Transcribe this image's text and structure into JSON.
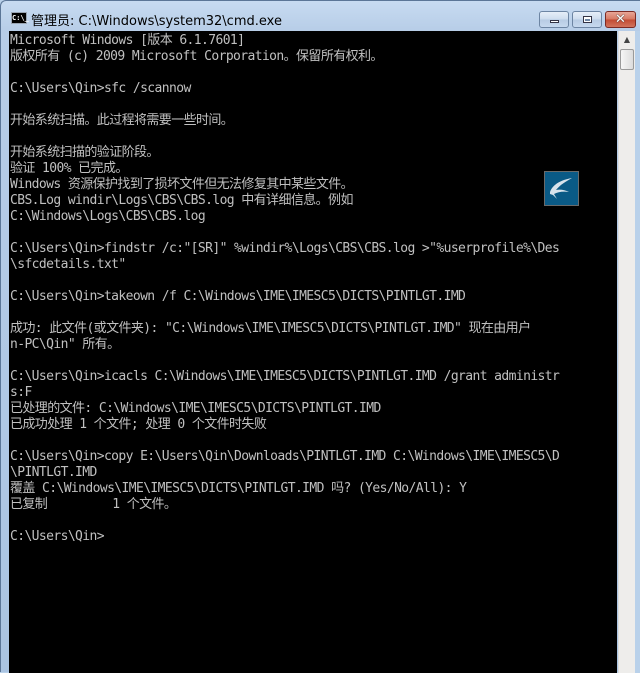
{
  "window": {
    "title": "管理员: C:\\Windows\\system32\\cmd.exe",
    "icon": "cmd-icon",
    "icon_label": "C:\\_",
    "buttons": {
      "minimize": "minimize-icon",
      "maximize": "maximize-icon",
      "close": "close-icon",
      "close_glyph": "✕"
    }
  },
  "console": {
    "background": "#000000",
    "foreground": "#c0c0c0",
    "lines": [
      "Microsoft Windows [版本 6.1.7601]",
      "版权所有 (c) 2009 Microsoft Corporation。保留所有权利。",
      "",
      "C:\\Users\\Qin>sfc /scannow",
      "",
      "开始系统扫描。此过程将需要一些时间。",
      "",
      "开始系统扫描的验证阶段。",
      "验证 100% 已完成。",
      "Windows 资源保护找到了损坏文件但无法修复其中某些文件。",
      "CBS.Log windir\\Logs\\CBS\\CBS.log 中有详细信息。例如",
      "C:\\Windows\\Logs\\CBS\\CBS.log",
      "",
      "C:\\Users\\Qin>findstr /c:\"[SR]\" %windir%\\Logs\\CBS\\CBS.log >\"%userprofile%\\Des",
      "\\sfcdetails.txt\"",
      "",
      "C:\\Users\\Qin>takeown /f C:\\Windows\\IME\\IMESC5\\DICTS\\PINTLGT.IMD",
      "",
      "成功: 此文件(或文件夹): \"C:\\Windows\\IME\\IMESC5\\DICTS\\PINTLGT.IMD\" 现在由用户",
      "n-PC\\Qin\" 所有。",
      "",
      "C:\\Users\\Qin>icacls C:\\Windows\\IME\\IMESC5\\DICTS\\PINTLGT.IMD /grant administr",
      "s:F",
      "已处理的文件: C:\\Windows\\IME\\IMESC5\\DICTS\\PINTLGT.IMD",
      "已成功处理 1 个文件; 处理 0 个文件时失败",
      "",
      "C:\\Users\\Qin>copy E:\\Users\\Qin\\Downloads\\PINTLGT.IMD C:\\Windows\\IME\\IMESC5\\D",
      "\\PINTLGT.IMD",
      "覆盖 C:\\Windows\\IME\\IMESC5\\DICTS\\PINTLGT.IMD 吗? (Yes/No/All): Y",
      "已复制         1 个文件。",
      "",
      "C:\\Users\\Qin>"
    ]
  },
  "overlay": {
    "icon": "bird-app-icon",
    "color": "#0a5a86"
  },
  "scrollbar": {
    "up_arrow": "▲"
  }
}
